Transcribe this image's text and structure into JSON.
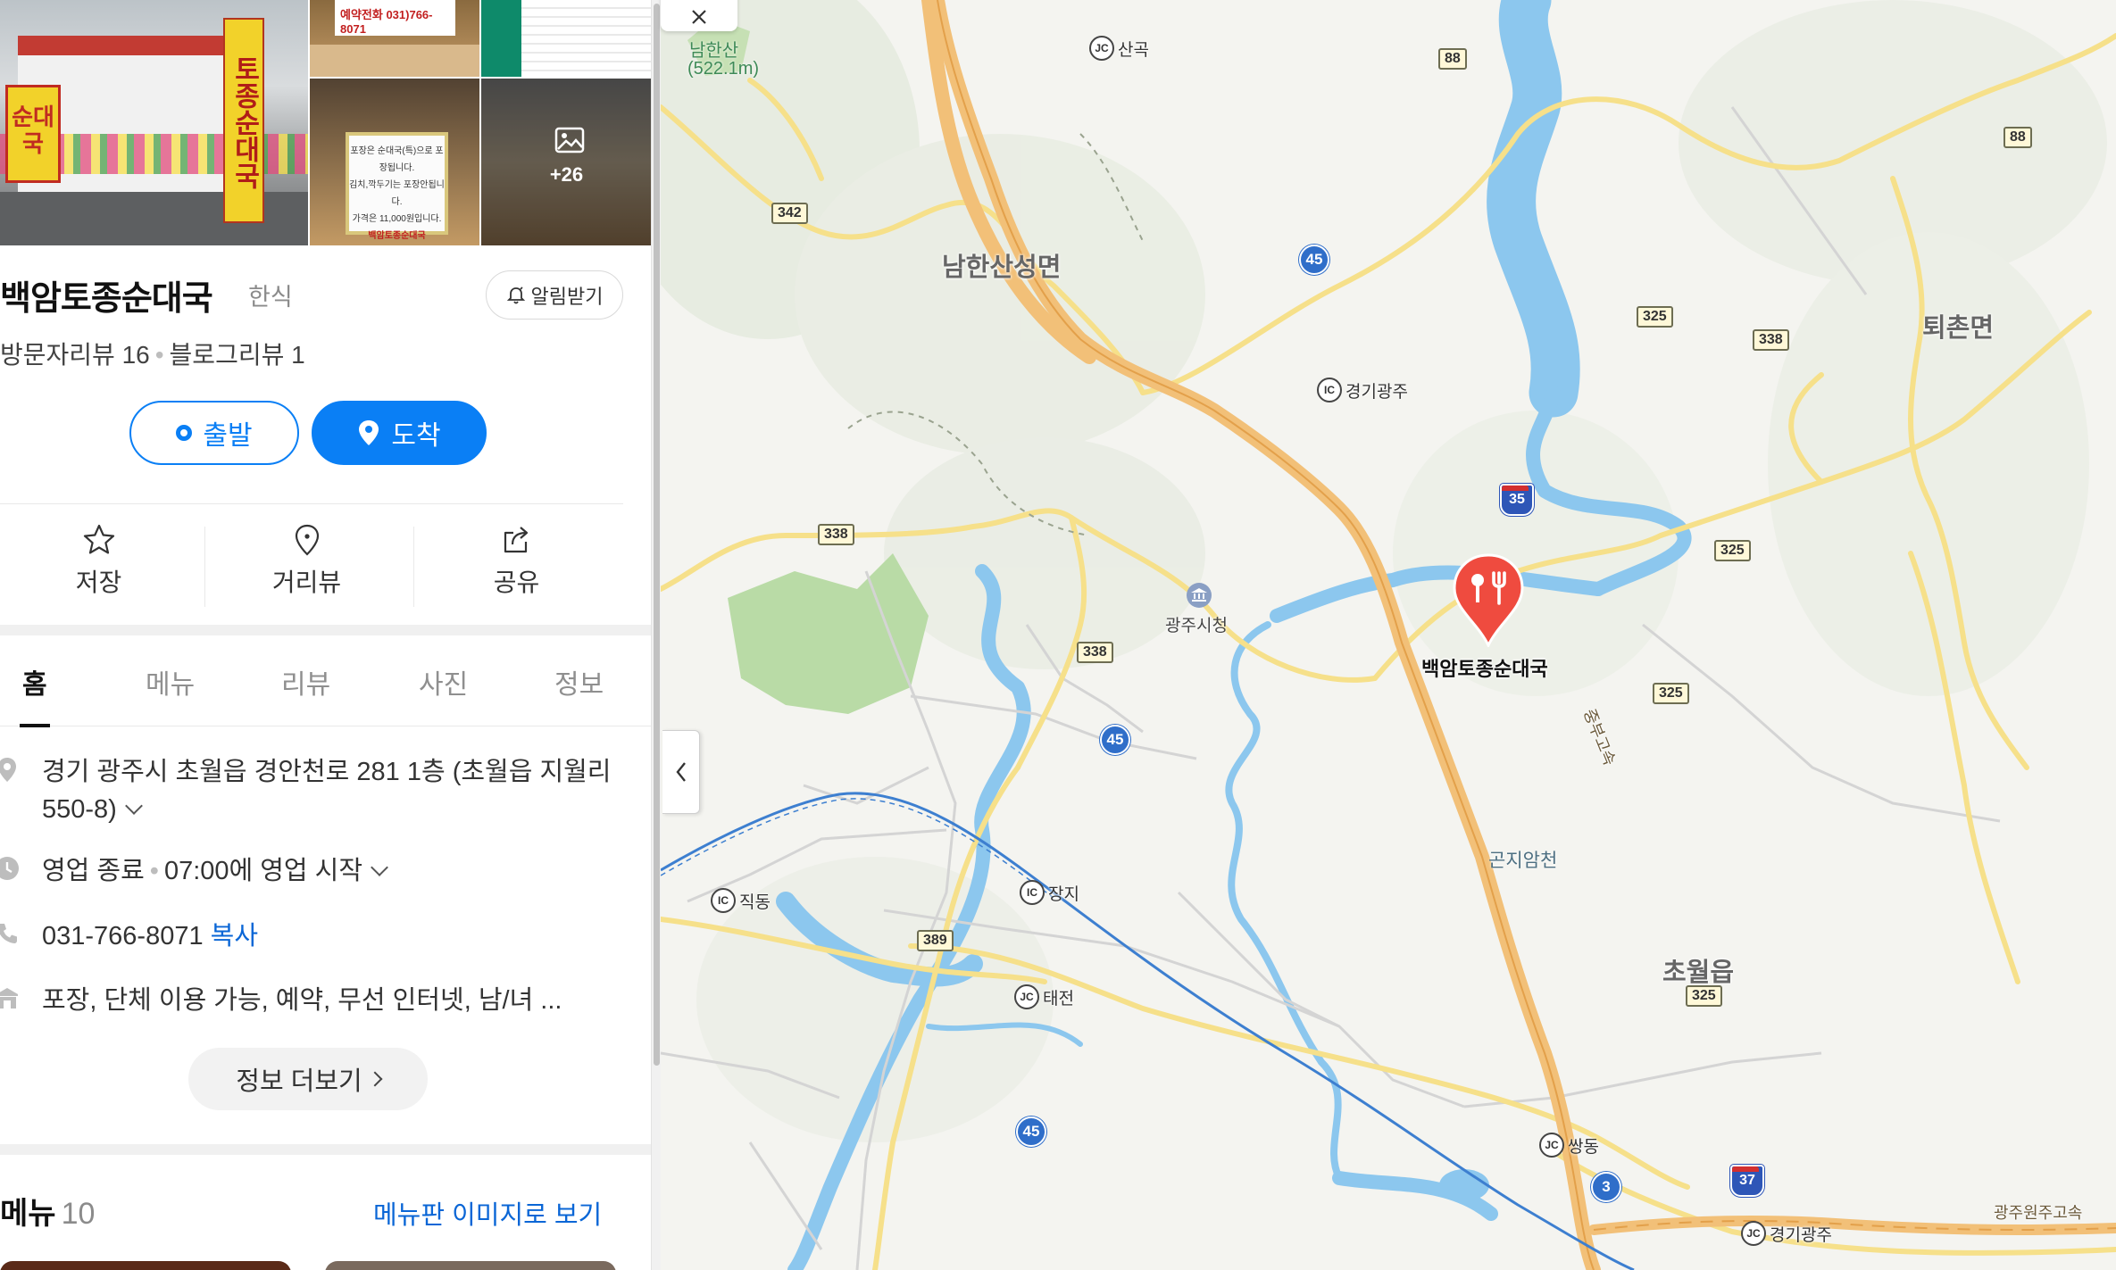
{
  "photos": {
    "main_sign": "토종순대국",
    "main_banner": "순대국",
    "phone_note": "예약전화 031)766-8071",
    "poster_line1": "포장은 순대국(특)으로 포장됩니다.",
    "poster_line2": "김치,깍두기는 포장안됩니다.",
    "poster_line3": "가격은 11,000원입니다.",
    "poster_brand": "백암토종순대국",
    "more_count": "+26"
  },
  "place": {
    "name": "백암토종순대국",
    "category": "한식",
    "alarm_label": "알림받기",
    "visitor_reviews": "방문자리뷰 16",
    "blog_reviews": "블로그리뷰 1"
  },
  "route": {
    "start": "출발",
    "arrive": "도착"
  },
  "actions": {
    "save": "저장",
    "streetview": "거리뷰",
    "share": "공유"
  },
  "tabs": [
    "홈",
    "메뉴",
    "리뷰",
    "사진",
    "정보"
  ],
  "info": {
    "address": "경기 광주시 초월읍 경안천로 281 1층 (초월읍 지월리 550-8)",
    "hours_status": "영업 종료",
    "hours_next": "07:00에 영업 시작",
    "phone": "031-766-8071",
    "copy_label": "복사",
    "amenities": "포장, 단체 이용 가능, 예약, 무선 인터넷, 남/녀 ..."
  },
  "more_info_label": "정보 더보기",
  "menu": {
    "title": "메뉴",
    "count": "10",
    "image_link": "메뉴판 이미지로 보기"
  },
  "map": {
    "towns": {
      "namhansan": "남한산성면",
      "toechon": "퇴촌면",
      "chowol": "초월읍"
    },
    "mountain": {
      "name": "남한산",
      "height": "(522.1m)"
    },
    "poi": {
      "cityhall": "광주시청",
      "stream": "곤지암천",
      "expressway": "중부고속",
      "expressway2": "광주원주고속"
    },
    "junctions": {
      "sangok": "산곡",
      "gyeonggi_gwangju_ic": "경기광주",
      "jikdong": "직동",
      "jangji": "장지",
      "taejeon": "태전",
      "ssangdong": "쌍동",
      "gyeonggi_gwangju_jc": "경기광주"
    },
    "route_numbers": {
      "r88a": "88",
      "r88b": "88",
      "r342": "342",
      "r338a": "338",
      "r338b": "338",
      "r338c": "338",
      "r325a": "325",
      "r325b": "325",
      "r325c": "325",
      "r325d": "325",
      "r389": "389",
      "n45a": "45",
      "n45b": "45",
      "n45c": "45",
      "n3": "3",
      "e35": "35",
      "e37": "37"
    },
    "selected_place": "백암토종순대국",
    "colors": {
      "primary": "#0a7ff5",
      "pin": "#ef4b3f",
      "water": "#8cc7ee",
      "highway": "#f2c078"
    }
  }
}
